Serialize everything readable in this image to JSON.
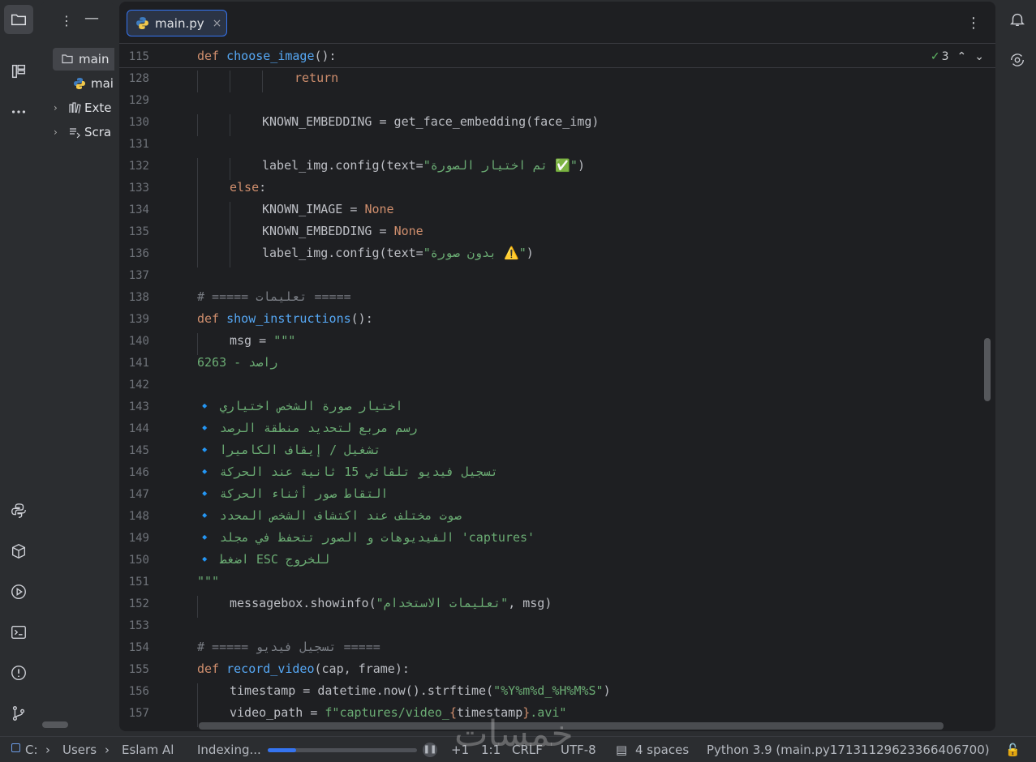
{
  "tab": {
    "filename": "main.py",
    "close": "×"
  },
  "project": {
    "items": [
      {
        "label": "main",
        "icon": "file-icon"
      },
      {
        "label": "main",
        "icon": "python-icon"
      },
      {
        "label": "Exte",
        "icon": "library-icon"
      },
      {
        "label": "Scra",
        "icon": "scratches-icon"
      }
    ]
  },
  "inspection": {
    "count": "3"
  },
  "code": {
    "lines": [
      {
        "n": "115",
        "indent": 0,
        "tokens": [
          [
            "kw",
            "def "
          ],
          [
            "fn",
            "choose_image"
          ],
          [
            "",
            "():"
          ]
        ]
      },
      {
        "n": "128",
        "indent": 3,
        "tokens": [
          [
            "kw",
            "return"
          ]
        ]
      },
      {
        "n": "129",
        "indent": 0,
        "tokens": []
      },
      {
        "n": "130",
        "indent": 2,
        "tokens": [
          [
            "",
            "KNOWN_EMBEDDING = get_face_embedding(face_img)"
          ]
        ]
      },
      {
        "n": "131",
        "indent": 0,
        "tokens": []
      },
      {
        "n": "132",
        "indent": 2,
        "tokens": [
          [
            "",
            "label_img.config(text="
          ],
          [
            "str",
            "\"تم اختيار الصورة ✅\""
          ],
          [
            "",
            ")"
          ]
        ]
      },
      {
        "n": "133",
        "indent": 1,
        "tokens": [
          [
            "kw",
            "else"
          ],
          [
            "",
            ":"
          ]
        ]
      },
      {
        "n": "134",
        "indent": 2,
        "tokens": [
          [
            "",
            "KNOWN_IMAGE = "
          ],
          [
            "kw",
            "None"
          ]
        ]
      },
      {
        "n": "135",
        "indent": 2,
        "tokens": [
          [
            "",
            "KNOWN_EMBEDDING = "
          ],
          [
            "kw",
            "None"
          ]
        ]
      },
      {
        "n": "136",
        "indent": 2,
        "tokens": [
          [
            "",
            "label_img.config(text="
          ],
          [
            "str",
            "\"بدون صورة ⚠️\""
          ],
          [
            "",
            ")"
          ]
        ]
      },
      {
        "n": "137",
        "indent": 0,
        "tokens": []
      },
      {
        "n": "138",
        "indent": 0,
        "tokens": [
          [
            "cmt",
            "# ===== تعليمات ====="
          ]
        ]
      },
      {
        "n": "139",
        "indent": 0,
        "tokens": [
          [
            "kw",
            "def "
          ],
          [
            "fn",
            "show_instructions"
          ],
          [
            "",
            "():"
          ]
        ]
      },
      {
        "n": "140",
        "indent": 1,
        "tokens": [
          [
            "",
            "msg = "
          ],
          [
            "str",
            "\"\"\""
          ]
        ]
      },
      {
        "n": "141",
        "indent": 0,
        "tokens": [
          [
            "str",
            "راصد - 6263"
          ]
        ]
      },
      {
        "n": "142",
        "indent": 0,
        "tokens": []
      },
      {
        "n": "143",
        "indent": 0,
        "tokens": [
          [
            "str",
            "🔹 اختيار صورة الشخص اختياري"
          ]
        ]
      },
      {
        "n": "144",
        "indent": 0,
        "tokens": [
          [
            "str",
            "🔹 رسم مربع لتحديد منطقة الرصد"
          ]
        ]
      },
      {
        "n": "145",
        "indent": 0,
        "tokens": [
          [
            "str",
            "🔹 تشغيل / إيقاف الكاميرا"
          ]
        ]
      },
      {
        "n": "146",
        "indent": 0,
        "tokens": [
          [
            "str",
            "🔹 تسجيل فيديو تلقائي 15 ثانية عند الحركة"
          ]
        ]
      },
      {
        "n": "147",
        "indent": 0,
        "tokens": [
          [
            "str",
            "🔹 التقاط صور أثناء الحركة"
          ]
        ]
      },
      {
        "n": "148",
        "indent": 0,
        "tokens": [
          [
            "str",
            "🔹 صوت مختلف عند اكتشاف الشخص المحدد"
          ]
        ]
      },
      {
        "n": "149",
        "indent": 0,
        "tokens": [
          [
            "str",
            "🔹 الفيديوهات و الصور تتحفظ في مجلد 'captures'"
          ]
        ]
      },
      {
        "n": "150",
        "indent": 0,
        "tokens": [
          [
            "str",
            "🔹 اضغط ESC للخروج"
          ]
        ]
      },
      {
        "n": "151",
        "indent": 0,
        "tokens": [
          [
            "str",
            "\"\"\""
          ]
        ]
      },
      {
        "n": "152",
        "indent": 1,
        "tokens": [
          [
            "",
            "messagebox.showinfo("
          ],
          [
            "str",
            "\"تعليمات الاستخدام\""
          ],
          [
            "",
            ", msg)"
          ]
        ]
      },
      {
        "n": "153",
        "indent": 0,
        "tokens": []
      },
      {
        "n": "154",
        "indent": 0,
        "tokens": [
          [
            "cmt",
            "# ===== تسجيل فيديو ====="
          ]
        ]
      },
      {
        "n": "155",
        "indent": 0,
        "tokens": [
          [
            "kw",
            "def "
          ],
          [
            "fn",
            "record_video"
          ],
          [
            "",
            "(cap, frame):"
          ]
        ]
      },
      {
        "n": "156",
        "indent": 1,
        "tokens": [
          [
            "",
            "timestamp = datetime.now().strftime("
          ],
          [
            "str",
            "\"%Y%m%d_%H%M%S\""
          ],
          [
            "",
            ")"
          ]
        ]
      },
      {
        "n": "157",
        "indent": 1,
        "tokens": [
          [
            "",
            "video_path = "
          ],
          [
            "str",
            "f\"captures/video_"
          ],
          [
            "kw",
            "{"
          ],
          [
            "",
            "timestamp"
          ],
          [
            "kw",
            "}"
          ],
          [
            "str",
            ".avi\""
          ]
        ]
      }
    ]
  },
  "status": {
    "breadcrumb": [
      "C:",
      "Users",
      "Eslam Al"
    ],
    "indexing": "Indexing...",
    "indexing_progress": 0.19,
    "changes": "+1",
    "position": "1:1",
    "line_sep": "CRLF",
    "encoding": "UTF-8",
    "indent": "4 spaces",
    "interpreter": "Python 3.9 (main.py17131129623366406700)"
  },
  "watermark": "خمسات",
  "colors": {
    "accent": "#3574f0",
    "keyword": "#cf8e6d",
    "string": "#6aab73",
    "function": "#56a8f5",
    "comment": "#7a7e85"
  }
}
